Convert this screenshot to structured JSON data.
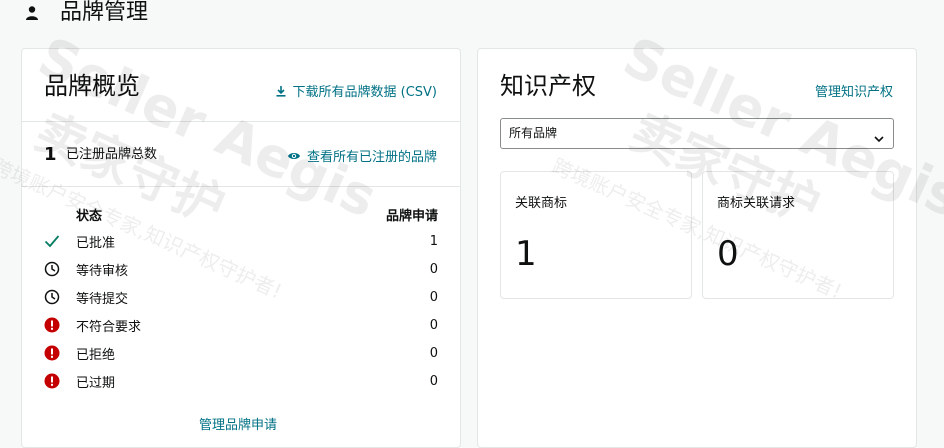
{
  "header": {
    "title": "品牌管理",
    "icon": "user-icon"
  },
  "overview": {
    "title": "品牌概览",
    "download_link": "下载所有品牌数据 (CSV)",
    "total_count": "1",
    "total_label": "已注册品牌总数",
    "view_all_link": "查看所有已注册的品牌",
    "table_header": {
      "status": "状态",
      "applications": "品牌申请"
    },
    "rows": [
      {
        "label": "已批准",
        "count": "1",
        "icon": "check-icon",
        "color": "#067d62"
      },
      {
        "label": "等待审核",
        "count": "0",
        "icon": "clock-icon",
        "color": "#0f1111"
      },
      {
        "label": "等待提交",
        "count": "0",
        "icon": "clock-icon",
        "color": "#0f1111"
      },
      {
        "label": "不符合要求",
        "count": "0",
        "icon": "alert-icon",
        "color": "#c40000"
      },
      {
        "label": "已拒绝",
        "count": "0",
        "icon": "alert-icon",
        "color": "#c40000"
      },
      {
        "label": "已过期",
        "count": "0",
        "icon": "alert-icon",
        "color": "#c40000"
      }
    ],
    "manage_link": "管理品牌申请"
  },
  "ip": {
    "title": "知识产权",
    "manage_link": "管理知识产权",
    "select_value": "所有品牌",
    "metrics": [
      {
        "label": "关联商标",
        "value": "1"
      },
      {
        "label": "商标关联请求",
        "value": "0"
      }
    ]
  },
  "watermark": {
    "brand": "Seller Aegis",
    "cn": "卖家守护",
    "slogan": "跨境账户安全专家,知识产权守护者!"
  },
  "colors": {
    "link": "#007185",
    "success": "#067d62",
    "error": "#c40000"
  }
}
